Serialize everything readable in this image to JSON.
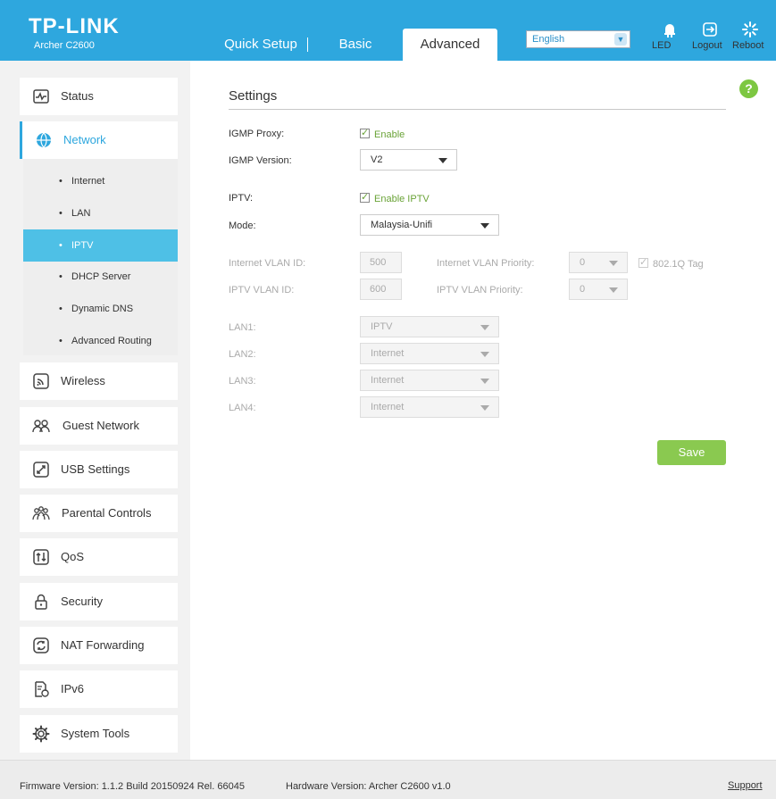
{
  "brand": {
    "logo": "TP-LINK",
    "model": "Archer C2600"
  },
  "tabs": {
    "quick_setup": "Quick Setup",
    "basic": "Basic",
    "advanced": "Advanced"
  },
  "language": {
    "selected": "English"
  },
  "header_icons": {
    "led": "LED",
    "logout": "Logout",
    "reboot": "Reboot"
  },
  "sidebar": {
    "status": "Status",
    "network": "Network",
    "network_sub": [
      "Internet",
      "LAN",
      "IPTV",
      "DHCP Server",
      "Dynamic DNS",
      "Advanced Routing"
    ],
    "wireless": "Wireless",
    "guest": "Guest Network",
    "usb": "USB Settings",
    "parental": "Parental Controls",
    "qos": "QoS",
    "security": "Security",
    "nat": "NAT Forwarding",
    "ipv6": "IPv6",
    "system": "System Tools"
  },
  "settings": {
    "title": "Settings",
    "help": "?",
    "igmp_proxy_label": "IGMP Proxy:",
    "igmp_proxy_enable": "Enable",
    "igmp_version_label": "IGMP Version:",
    "igmp_version": "V2",
    "iptv_label": "IPTV:",
    "iptv_enable": "Enable IPTV",
    "mode_label": "Mode:",
    "mode": "Malaysia-Unifi",
    "internet_vlan_id_label": "Internet VLAN ID:",
    "internet_vlan_id": "500",
    "internet_vlan_priority_label": "Internet VLAN Priority:",
    "internet_vlan_priority": "0",
    "tag_8021q": "802.1Q Tag",
    "iptv_vlan_id_label": "IPTV VLAN ID:",
    "iptv_vlan_id": "600",
    "iptv_vlan_priority_label": "IPTV VLAN Priority:",
    "iptv_vlan_priority": "0",
    "lan1_label": "LAN1:",
    "lan1": "IPTV",
    "lan2_label": "LAN2:",
    "lan2": "Internet",
    "lan3_label": "LAN3:",
    "lan3": "Internet",
    "lan4_label": "LAN4:",
    "lan4": "Internet",
    "save": "Save"
  },
  "footer": {
    "firmware": "Firmware Version: 1.1.2 Build 20150924 Rel. 66045",
    "hardware": "Hardware Version: Archer C2600 v1.0",
    "support": "Support"
  },
  "colors": {
    "header": "#2ea7de",
    "active_sub": "#4ec0e6",
    "accent_green": "#8ac950",
    "help_green": "#7dc742"
  }
}
